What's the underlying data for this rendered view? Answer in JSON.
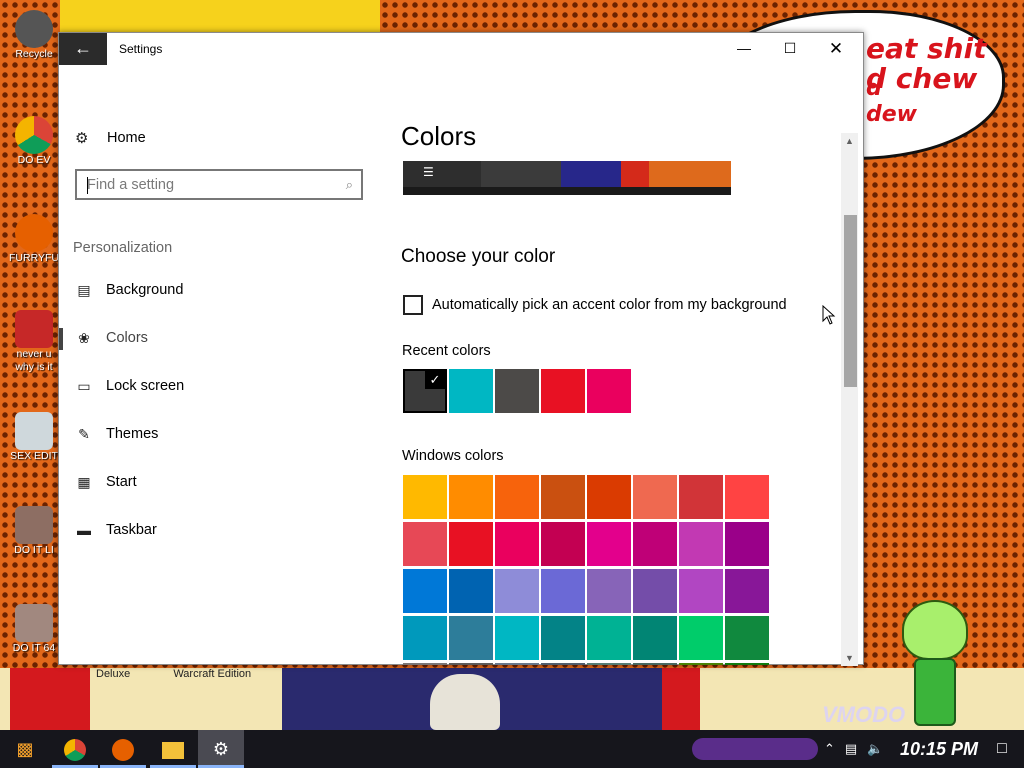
{
  "desktop": {
    "bubble_lines": [
      "eat shit",
      "d chew",
      "d",
      "dew"
    ],
    "icons": [
      {
        "label": "Recycle",
        "color": "#6b6b6b"
      },
      {
        "label": "DO EV",
        "color": "#1e88e5"
      },
      {
        "label": "FURRYFU",
        "color": "#e56a1e"
      },
      {
        "label": "never u",
        "label2": "why is it",
        "color": "#c62828"
      },
      {
        "label": "SEX EDIT",
        "color": "#cfd8dc"
      },
      {
        "label": "DO IT LI",
        "color": "#8d6e63"
      },
      {
        "label": "DO IT 64",
        "color": "#a1887f"
      }
    ],
    "bottom_labels": [
      "Deluxe",
      "Warcraft Edition"
    ],
    "watermark": "VMODO"
  },
  "window": {
    "title": "Settings",
    "back_icon": "back-arrow-icon",
    "controls": {
      "minimize": "—",
      "maximize": "☐",
      "close": "✕"
    }
  },
  "nav": {
    "home_label": "Home",
    "search": {
      "placeholder": "Find a setting",
      "value": ""
    },
    "section_header": "Personalization",
    "items": [
      {
        "label": "Background",
        "icon": "picture-icon",
        "active": false
      },
      {
        "label": "Colors",
        "icon": "palette-icon",
        "active": true
      },
      {
        "label": "Lock screen",
        "icon": "lock-screen-icon",
        "active": false
      },
      {
        "label": "Themes",
        "icon": "themes-icon",
        "active": false
      },
      {
        "label": "Start",
        "icon": "start-icon",
        "active": false
      },
      {
        "label": "Taskbar",
        "icon": "taskbar-icon",
        "active": false
      }
    ]
  },
  "content": {
    "page_title": "Colors",
    "section_title": "Choose your color",
    "auto_pick": {
      "label": "Automatically pick an accent color from my background",
      "checked": false
    },
    "recent_label": "Recent colors",
    "recent_colors": [
      "#3a3a3a",
      "#00b7c3",
      "#4c4a48",
      "#e81123",
      "#ea005e"
    ],
    "recent_selected_index": 0,
    "windows_label": "Windows colors",
    "windows_colors": [
      [
        "#ffb900",
        "#ff8c00",
        "#f7630c",
        "#ca5010",
        "#da3b01",
        "#ef6950",
        "#d13438",
        "#ff4343"
      ],
      [
        "#e74856",
        "#e81123",
        "#ea005e",
        "#c30052",
        "#e3008c",
        "#bf0077",
        "#c239b3",
        "#9a0089"
      ],
      [
        "#0078d7",
        "#0063b1",
        "#8e8cd8",
        "#6b69d6",
        "#8764b8",
        "#744da9",
        "#b146c2",
        "#881798"
      ],
      [
        "#0099bc",
        "#2d7d9a",
        "#00b7c3",
        "#038387",
        "#00b294",
        "#018574",
        "#00cc6a",
        "#10893e"
      ],
      [
        "#7a7574",
        "#5d5a58",
        "#68768a",
        "#515c6b",
        "#567c73",
        "#486860",
        "#498205",
        "#107c10"
      ]
    ]
  },
  "taskbar": {
    "clock": "10:15 PM",
    "tray_icons": [
      "chevron-up-icon",
      "network-icon",
      "volume-icon"
    ]
  }
}
